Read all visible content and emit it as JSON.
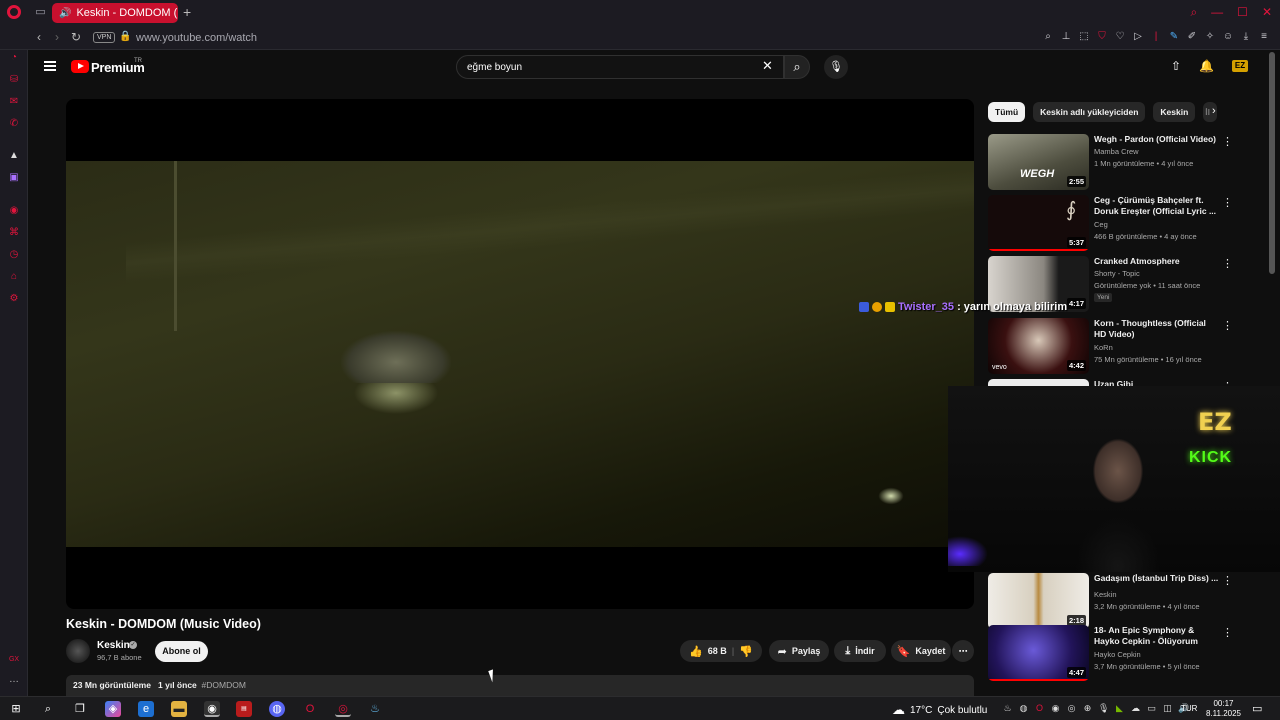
{
  "browser": {
    "tab_title": "Keskin - DOMDOM (M",
    "url": "www.youtube.com/watch",
    "vpn_label": "VPN"
  },
  "header": {
    "brand": "Premium",
    "region": "TR",
    "search_value": "eğme boyun"
  },
  "video": {
    "title": "Keskin - DOMDOM (Music Video)",
    "channel": "Keskin",
    "subscribers": "96,7 B abone",
    "subscribe_label": "Abone ol",
    "likes": "68 B",
    "share_label": "Paylaş",
    "download_label": "İndir",
    "save_label": "Kaydet",
    "views": "23 Mn görüntüleme",
    "age": "1 yıl önce",
    "hashtag": "#DOMDOM"
  },
  "chips": [
    "Tümü",
    "Keskin adlı yükleyiciden",
    "Keskin",
    "İl"
  ],
  "recommendations": [
    {
      "title": "Wegh - Pardon (Official Video)",
      "channel": "Mamba Crew",
      "meta": "1 Mn görüntüleme • 4 yıl önce",
      "duration": "2:55",
      "thumb_color": "#6b6a58"
    },
    {
      "title": "Ceg - Çürümüş Bahçeler ft. Doruk Ereşter (Official Lyric ...",
      "channel": "Ceg",
      "meta": "466 B görüntüleme • 4 ay önce",
      "duration": "5:37",
      "thumb_color": "#2a1010"
    },
    {
      "title": "Cranked Atmosphere",
      "channel": "Shorty - Topic",
      "meta": "Görüntüleme yok • 11 saat önce",
      "badge": "Yeni",
      "duration": "4:17",
      "thumb_color": "#b9b4ae"
    },
    {
      "title": "Korn - Thoughtless (Official HD Video)",
      "channel": "KoRn",
      "meta": "75 Mn görüntüleme • 16 yıl önce",
      "duration": "4:42",
      "thumb_color": "#4a1a1a"
    },
    {
      "title": "Uzan Gibi",
      "channel": "",
      "meta": "",
      "duration": "",
      "thumb_color": "#f0f0f0"
    },
    {
      "title": "Gadaşım (İstanbul Trip Diss) ...",
      "channel": "Keskin",
      "meta": "3,2 Mn görüntüleme • 4 yıl önce",
      "duration": "2:18",
      "thumb_color": "#e8e4dc"
    },
    {
      "title": "18- An Epic Symphony & Hayko Cepkin - Ölüyorum",
      "channel": "Hayko Cepkin",
      "meta": "3,7 Mn görüntüleme • 5 yıl önce",
      "duration": "4:47",
      "thumb_color": "#2a1a6a"
    }
  ],
  "overlay": {
    "chat_user": "Twister_35",
    "chat_message": ": yarın olmaya bilirim",
    "neon_top": "EZ",
    "neon_bottom": "KICK"
  },
  "taskbar": {
    "temperature": "17°C",
    "weather": "Çok bulutlu",
    "language": "TUR",
    "time": "00:17",
    "date": "8.11.2025"
  },
  "colors": {
    "accent": "#e0143c",
    "youtube_red": "#ff0000",
    "kick_green": "#53fc18"
  }
}
